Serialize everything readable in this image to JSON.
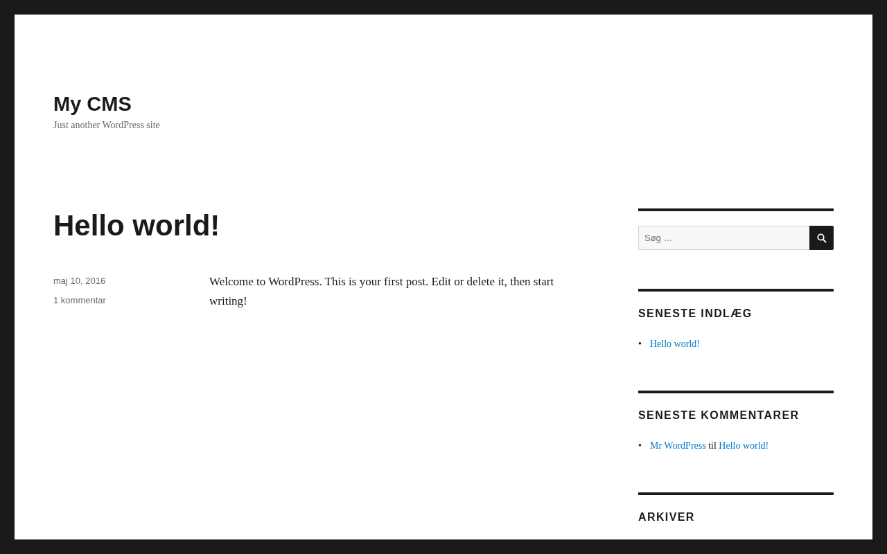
{
  "site": {
    "title": "My CMS",
    "tagline": "Just another WordPress site"
  },
  "post": {
    "title": "Hello world!",
    "date": "maj 10, 2016",
    "comments": "1 kommentar",
    "body": "Welcome to WordPress. This is your first post. Edit or delete it, then start writing!"
  },
  "sidebar": {
    "search": {
      "placeholder": "Søg …"
    },
    "widgets": [
      {
        "kind": "posts",
        "title": "SENESTE INDLÆG",
        "items": [
          {
            "bullet": "•",
            "link": "Hello world!"
          }
        ]
      },
      {
        "kind": "comments",
        "title": "SENESTE KOMMENTARER",
        "items": [
          {
            "bullet": "•",
            "author": "Mr WordPress",
            "joiner": "til",
            "post": "Hello world!"
          }
        ]
      },
      {
        "kind": "archive",
        "title": "ARKIVER"
      }
    ]
  }
}
